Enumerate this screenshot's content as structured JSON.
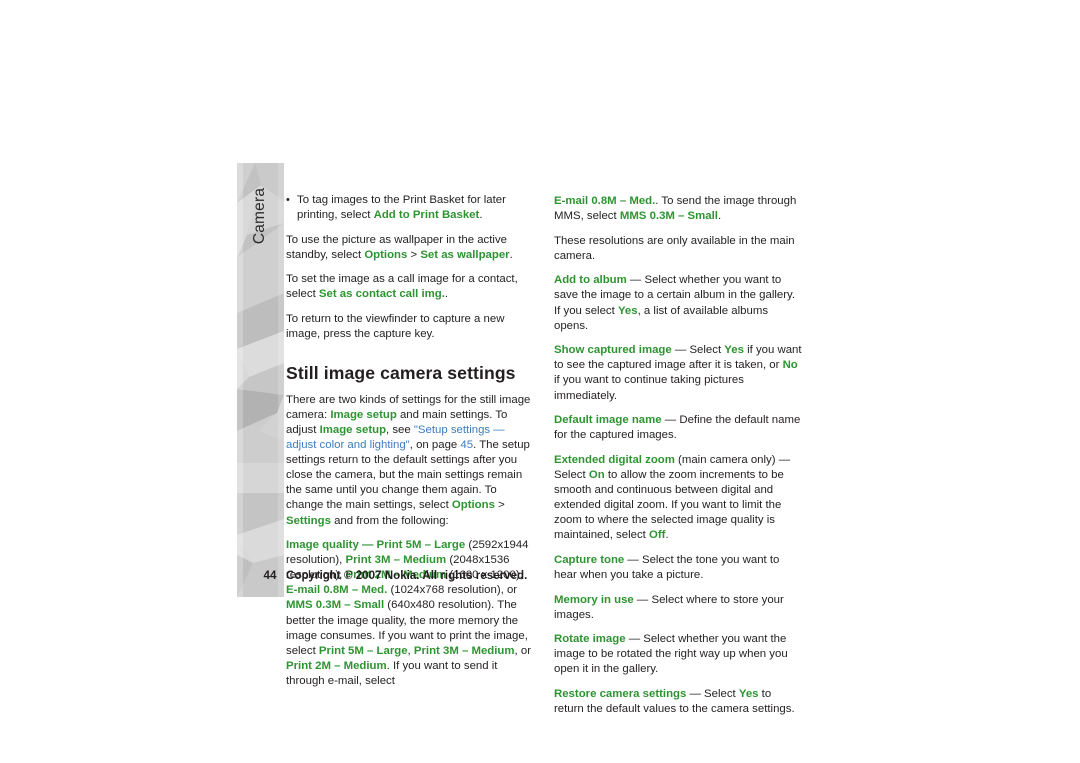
{
  "document": {
    "chapter_label": "Camera",
    "page_number": "44",
    "copyright": "Copyright © 2007 Nokia. All rights reserved."
  },
  "colors": {
    "accent_green": "#2e9432",
    "link_blue": "#3d7cbe",
    "body_text": "#231f20",
    "tab_gray_light": "#e3e3e3",
    "tab_gray_mid": "#c9c9c9",
    "tab_gray_dark": "#a9a9a9"
  },
  "left_column": {
    "bullet": {
      "marker": "•",
      "text_before": "To tag images to the Print Basket for later printing, select ",
      "term": "Add to Print Basket",
      "text_after": "."
    },
    "paragraphs": [
      {
        "id": "wallpaper",
        "runs": [
          {
            "t": "To use the picture as wallpaper in the active standby, select ",
            "s": "plain"
          },
          {
            "t": "Options",
            "s": "green"
          },
          {
            "t": " > ",
            "s": "plain"
          },
          {
            "t": "Set as wallpaper",
            "s": "green"
          },
          {
            "t": ".",
            "s": "plain"
          }
        ]
      },
      {
        "id": "contact-call-image",
        "runs": [
          {
            "t": "To set the image as a call image for a contact, select ",
            "s": "plain"
          },
          {
            "t": "Set as contact call img.",
            "s": "green"
          },
          {
            "t": ".",
            "s": "plain"
          }
        ]
      },
      {
        "id": "return-viewfinder",
        "runs": [
          {
            "t": "To return to the viewfinder to capture a new image, press the capture key.",
            "s": "plain"
          }
        ]
      }
    ],
    "section_title": "Still image camera settings",
    "body_paragraphs": [
      {
        "id": "two-kinds-of-settings",
        "runs": [
          {
            "t": "There are two kinds of settings for the still image camera: ",
            "s": "plain"
          },
          {
            "t": "Image setup",
            "s": "green"
          },
          {
            "t": " and main settings. To adjust ",
            "s": "plain"
          },
          {
            "t": "Image setup",
            "s": "green"
          },
          {
            "t": ", see ",
            "s": "plain"
          },
          {
            "t": "\"Setup settings — adjust color and lighting\"",
            "s": "link"
          },
          {
            "t": ", on page ",
            "s": "plain"
          },
          {
            "t": "45",
            "s": "link"
          },
          {
            "t": ". The setup settings return to the default settings after you close the camera, but the main settings remain the same until you change them again. To change the main settings, select ",
            "s": "plain"
          },
          {
            "t": "Options",
            "s": "green"
          },
          {
            "t": " > ",
            "s": "plain"
          },
          {
            "t": "Settings",
            "s": "green"
          },
          {
            "t": " and from the following:",
            "s": "plain"
          }
        ]
      },
      {
        "id": "image-quality",
        "runs": [
          {
            "t": "Image quality",
            "s": "green"
          },
          {
            "t": " — ",
            "s": "green"
          },
          {
            "t": "Print 5M – Large",
            "s": "green"
          },
          {
            "t": " (2592x1944 resolution), ",
            "s": "plain"
          },
          {
            "t": "Print 3M – Medium",
            "s": "green"
          },
          {
            "t": " (2048x1536 resolution), ",
            "s": "plain"
          },
          {
            "t": "Print 2M – Medium",
            "s": "green"
          },
          {
            "t": " (1600 x 1200), ",
            "s": "plain"
          },
          {
            "t": "E-mail 0.8M – Med.",
            "s": "green"
          },
          {
            "t": " (1024x768 resolution), or ",
            "s": "plain"
          },
          {
            "t": "MMS 0.3M – Small",
            "s": "green"
          },
          {
            "t": " (640x480 resolution). The better the image quality, the more memory the image consumes. If you want to print the image, select ",
            "s": "plain"
          },
          {
            "t": "Print 5M – Large",
            "s": "green"
          },
          {
            "t": ", ",
            "s": "plain"
          },
          {
            "t": "Print 3M – Medium",
            "s": "green"
          },
          {
            "t": ", or ",
            "s": "plain"
          },
          {
            "t": "Print 2M – Medium",
            "s": "green"
          },
          {
            "t": ". If you want to send it through e-mail, select ",
            "s": "plain"
          }
        ]
      }
    ]
  },
  "right_column": {
    "paragraphs": [
      {
        "id": "email-mms-continuation",
        "runs": [
          {
            "t": "E-mail 0.8M – Med.",
            "s": "green"
          },
          {
            "t": ". To send the image through MMS, select ",
            "s": "plain"
          },
          {
            "t": "MMS 0.3M – Small",
            "s": "green"
          },
          {
            "t": ".",
            "s": "plain"
          }
        ]
      },
      {
        "id": "resolutions-main-camera",
        "runs": [
          {
            "t": "These resolutions are only available in the main camera.",
            "s": "plain"
          }
        ]
      },
      {
        "id": "add-to-album",
        "runs": [
          {
            "t": "Add to album",
            "s": "green"
          },
          {
            "t": " — Select whether you want to save the image to a certain album in the gallery. If you select ",
            "s": "plain"
          },
          {
            "t": "Yes",
            "s": "green"
          },
          {
            "t": ", a list of available albums opens.",
            "s": "plain"
          }
        ]
      },
      {
        "id": "show-captured-image",
        "runs": [
          {
            "t": "Show captured image",
            "s": "green"
          },
          {
            "t": " — Select ",
            "s": "plain"
          },
          {
            "t": "Yes",
            "s": "green"
          },
          {
            "t": " if you want to see the captured image after it is taken, or ",
            "s": "plain"
          },
          {
            "t": "No",
            "s": "green"
          },
          {
            "t": " if you want to continue taking pictures immediately.",
            "s": "plain"
          }
        ]
      },
      {
        "id": "default-image-name",
        "runs": [
          {
            "t": "Default image name",
            "s": "green"
          },
          {
            "t": " — Define the default name for the captured images.",
            "s": "plain"
          }
        ]
      },
      {
        "id": "extended-digital-zoom",
        "runs": [
          {
            "t": "Extended digital zoom",
            "s": "green"
          },
          {
            "t": " (main camera only) — Select ",
            "s": "plain"
          },
          {
            "t": "On",
            "s": "green"
          },
          {
            "t": " to allow the zoom increments to be smooth and continuous between digital and extended digital zoom. If you want to limit the zoom to where the selected image quality is maintained, select ",
            "s": "plain"
          },
          {
            "t": "Off",
            "s": "green"
          },
          {
            "t": ".",
            "s": "plain"
          }
        ]
      },
      {
        "id": "capture-tone",
        "runs": [
          {
            "t": "Capture tone",
            "s": "green"
          },
          {
            "t": " — Select the tone you want to hear when you take a picture.",
            "s": "plain"
          }
        ]
      },
      {
        "id": "memory-in-use",
        "runs": [
          {
            "t": "Memory in use",
            "s": "green"
          },
          {
            "t": " — Select where to store your images.",
            "s": "plain"
          }
        ]
      },
      {
        "id": "rotate-image",
        "runs": [
          {
            "t": "Rotate image",
            "s": "green"
          },
          {
            "t": " — Select whether you want the image to be rotated the right way up when you open it in the gallery.",
            "s": "plain"
          }
        ]
      },
      {
        "id": "restore-camera-settings",
        "runs": [
          {
            "t": "Restore camera settings",
            "s": "green"
          },
          {
            "t": " — Select ",
            "s": "plain"
          },
          {
            "t": "Yes",
            "s": "green"
          },
          {
            "t": " to return the default values to the camera settings.",
            "s": "plain"
          }
        ]
      }
    ]
  }
}
